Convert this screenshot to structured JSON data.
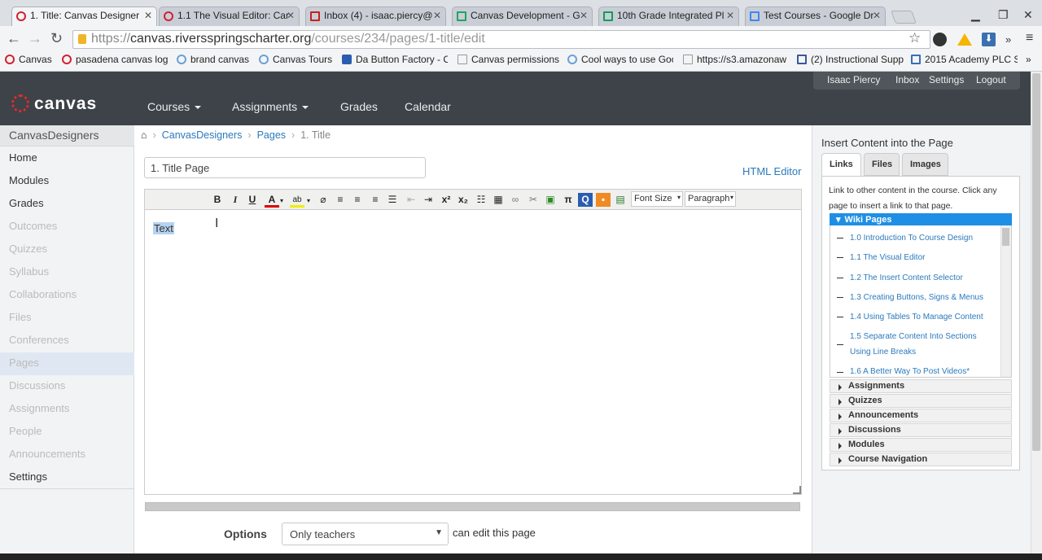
{
  "browser": {
    "tabs": [
      {
        "label": "1. Title: Canvas Designer"
      },
      {
        "label": "1.1 The Visual Editor: Car"
      },
      {
        "label": "Inbox (4) - isaac.piercy@"
      },
      {
        "label": "Canvas Development - G"
      },
      {
        "label": "10th Grade Integrated Pl"
      },
      {
        "label": "Test Courses - Google Dr"
      }
    ],
    "url": {
      "proto": "https://",
      "host": "canvas.riversspringscharter.org",
      "path": "/courses/234/pages/1-title/edit"
    },
    "bookmarks": [
      "Canvas",
      "pasadena canvas log",
      "brand canvas",
      "Canvas Tours",
      "Da Button Factory - C",
      "Canvas permissions",
      "Cool ways to use Goo",
      "https://s3.amazonaw",
      "(2) Instructional Supp",
      "2015 Academy PLC S"
    ]
  },
  "header": {
    "logo": "canvas",
    "user_links": [
      "Isaac Piercy",
      "Inbox",
      "Settings",
      "Logout"
    ],
    "nav": [
      "Courses",
      "Assignments",
      "Grades",
      "Calendar"
    ]
  },
  "leftnav": {
    "course": "CanvasDesigners",
    "items": [
      "Home",
      "Modules",
      "Grades",
      "Outcomes",
      "Quizzes",
      "Syllabus",
      "Collaborations",
      "Files",
      "Conferences",
      "Pages",
      "Discussions",
      "Assignments",
      "People",
      "Announcements",
      "Settings"
    ]
  },
  "breadcrumb": [
    "CanvasDesigners",
    "Pages",
    "1. Title"
  ],
  "editor": {
    "title_value": "1. Title Page",
    "html_editor_link": "HTML Editor",
    "font_size": "Font Size",
    "paragraph": "Paragraph",
    "content": "Text"
  },
  "options": {
    "label": "Options",
    "value": "Only teachers",
    "after": "can edit this page"
  },
  "right_panel": {
    "title": "Insert Content into the Page",
    "tabs": [
      "Links",
      "Files",
      "Images"
    ],
    "help": "Link to other content in the course. Click any page to insert a link to that page.",
    "wiki_header": "Wiki Pages",
    "wiki_pages": [
      "1.0 Introduction To Course Design",
      "1.1 The Visual Editor",
      "1.2 The Insert Content Selector",
      "1.3 Creating Buttons, Signs & Menus",
      "1.4 Using Tables To Manage Content",
      "1.5 Separate Content Into Sections Using Line Breaks",
      "1.6 A Better Way To Post Videos*"
    ],
    "categories": [
      "Assignments",
      "Quizzes",
      "Announcements",
      "Discussions",
      "Modules",
      "Course Navigation"
    ]
  }
}
